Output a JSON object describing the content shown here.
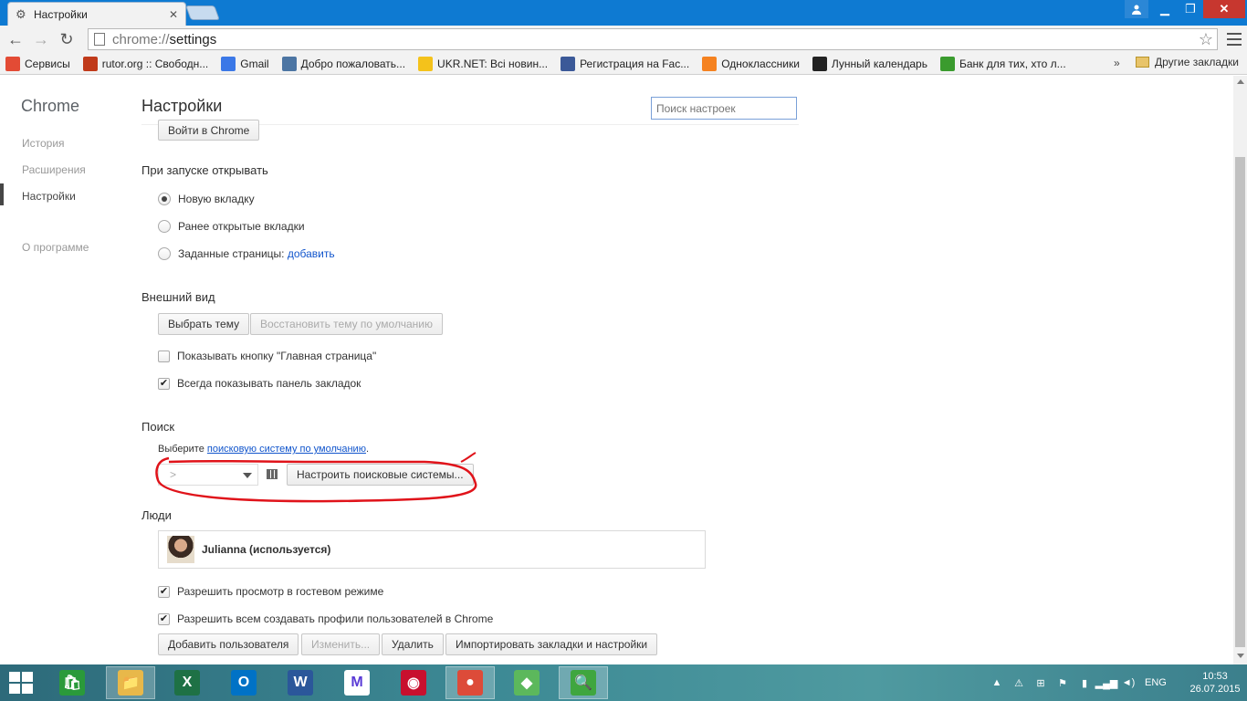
{
  "window": {
    "tab_title": "Настройки",
    "tab_close": "✕",
    "user_icon": "user-icon",
    "minimize": "▁",
    "maximize": "❐",
    "close": "✕"
  },
  "toolbar": {
    "back": "←",
    "forward": "→",
    "reload": "↻",
    "url_scheme": "chrome://",
    "url_host": "settings",
    "star": "☆"
  },
  "bookmarks": {
    "items": [
      {
        "label": "Сервисы",
        "icon": "apps-grid-icon",
        "color": "#e34b35"
      },
      {
        "label": "rutor.org :: Свободн...",
        "icon": "rutor-icon",
        "color": "#c03a1a"
      },
      {
        "label": "Gmail",
        "icon": "google-icon",
        "color": "#3b78e7"
      },
      {
        "label": "Добро пожаловать...",
        "icon": "vk-icon",
        "color": "#4c75a3"
      },
      {
        "label": "UKR.NET: Всі новин...",
        "icon": "ukrnet-icon",
        "color": "#f4c21b"
      },
      {
        "label": "Регистрация на Fac...",
        "icon": "facebook-icon",
        "color": "#3b5998"
      },
      {
        "label": "Одноклассники",
        "icon": "odnoklassniki-icon",
        "color": "#f58220"
      },
      {
        "label": "Лунный календарь",
        "icon": "moon-icon",
        "color": "#222222"
      },
      {
        "label": "Банк для тих, хто л...",
        "icon": "privatbank-icon",
        "color": "#3a9b2e"
      }
    ],
    "more": "»",
    "other": "Другие закладки"
  },
  "sidebar": {
    "title": "Chrome",
    "items": [
      {
        "label": "История"
      },
      {
        "label": "Расширения"
      },
      {
        "label": "Настройки"
      },
      {
        "label": "О программе"
      }
    ]
  },
  "settings": {
    "title": "Настройки",
    "search_placeholder": "Поиск настроек",
    "signin_button": "Войти в Chrome",
    "startup": {
      "title": "При запуске открывать",
      "opt_newtab": "Новую вкладку",
      "opt_restore": "Ранее открытые вкладки",
      "opt_pages": "Заданные страницы:",
      "opt_pages_link": "добавить",
      "selected": "Новую вкладку"
    },
    "appearance": {
      "title": "Внешний вид",
      "theme_button": "Выбрать тему",
      "reset_theme_button": "Восстановить тему по умолчанию",
      "show_home": "Показывать кнопку \"Главная страница\"",
      "show_home_checked": false,
      "show_bookmarks": "Всегда показывать панель закладок",
      "show_bookmarks_checked": true
    },
    "search": {
      "title": "Поиск",
      "desc_prefix": "Выберите ",
      "desc_link": "поисковую систему по умолчанию",
      "desc_suffix": ".",
      "engine_value": ">",
      "manage_button": "Настроить поисковые системы...",
      "annotation_color": "#e0131a"
    },
    "people": {
      "title": "Люди",
      "profile_name": "Julianna (используется)",
      "guest": "Разрешить просмотр в гостевом режиме",
      "guest_checked": true,
      "allow_profiles": "Разрешить всем создавать профили пользователей в Chrome",
      "allow_profiles_checked": true,
      "add_button": "Добавить пользователя",
      "edit_button": "Изменить...",
      "delete_button": "Удалить",
      "import_button": "Импортировать закладки и настройки"
    }
  },
  "taskbar": {
    "apps": [
      {
        "name": "store-icon",
        "glyph": "🛍",
        "color": "#2a9a3a"
      },
      {
        "name": "file-explorer-icon",
        "glyph": "📁",
        "color": "#e8b84a"
      },
      {
        "name": "excel-icon",
        "glyph": "X",
        "color": "#1e7145"
      },
      {
        "name": "outlook-icon",
        "glyph": "O",
        "color": "#0072c6"
      },
      {
        "name": "word-icon",
        "glyph": "W",
        "color": "#2b579a"
      },
      {
        "name": "paint-app-icon",
        "glyph": "M",
        "color": "#ffffff"
      },
      {
        "name": "camera-icon",
        "glyph": "◉",
        "color": "#c8102e"
      },
      {
        "name": "chrome-icon",
        "glyph": "●",
        "color": "#dd4b39"
      },
      {
        "name": "sims-icon",
        "glyph": "◆",
        "color": "#5cb85c"
      },
      {
        "name": "security-scan-icon",
        "glyph": "🔍",
        "color": "#3fa63f"
      }
    ],
    "lang": "ENG",
    "time": "10:53",
    "date": "26.07.2015"
  }
}
